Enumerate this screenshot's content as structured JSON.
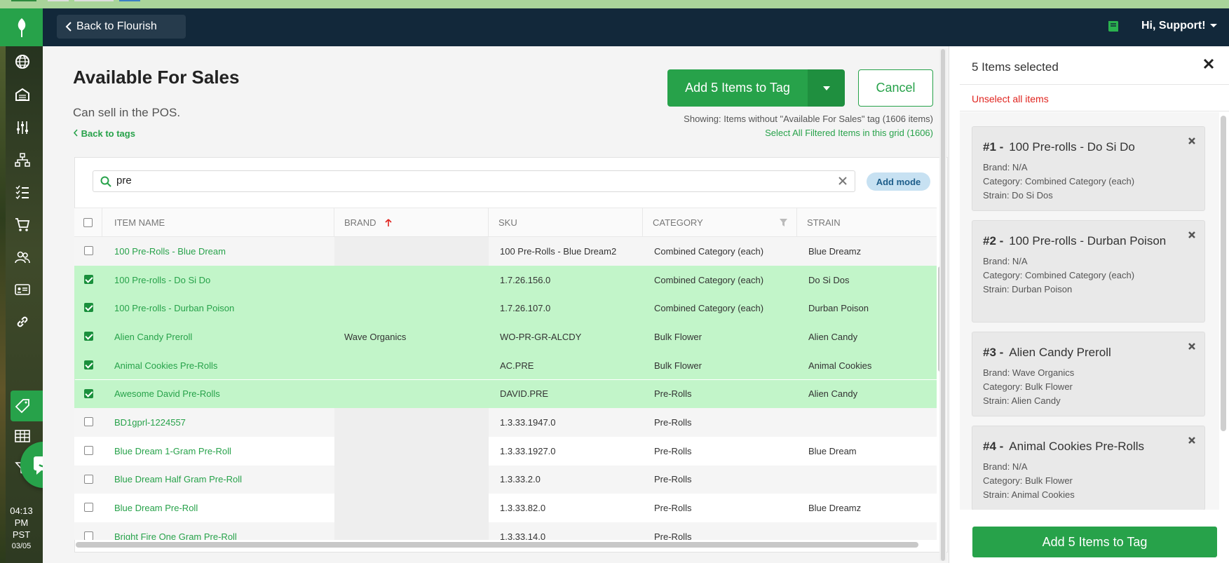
{
  "header": {
    "back_label": "Back to Flourish",
    "user_label": "Hi, Support!"
  },
  "nav_icons": [
    "globe-icon",
    "warehouse-icon",
    "sliders-icon",
    "org-chart-icon",
    "checklist-icon",
    "cart-icon",
    "users-icon",
    "id-card-icon",
    "link-icon",
    "tag-icon",
    "table-icon",
    "filter-icon"
  ],
  "clock": {
    "time": "04:13",
    "ampm": "PM",
    "tz": "PST",
    "date": "03/05"
  },
  "page": {
    "title": "Available For Sales",
    "description": "Can sell in the POS.",
    "back_to_tags": "Back to tags",
    "add_button": "Add 5 Items to Tag",
    "cancel_button": "Cancel",
    "showing": "Showing: Items without \"Available For Sales\" tag (1606 items)",
    "select_all": "Select All Filtered Items in this grid (1606)"
  },
  "search": {
    "value": "pre",
    "add_mode": "Add mode"
  },
  "columns": {
    "item_name": "ITEM NAME",
    "brand": "BRAND",
    "sku": "SKU",
    "category": "CATEGORY",
    "strain": "STRAIN"
  },
  "rows": [
    {
      "name": "100 Pre-Rolls - Blue Dream",
      "brand": "",
      "sku": "100 Pre-Rolls - Blue Dream2",
      "category": "Combined Category (each)",
      "strain": "Blue Dreamz",
      "selected": false
    },
    {
      "name": "100 Pre-rolls - Do Si Do",
      "brand": "",
      "sku": "1.7.26.156.0",
      "category": "Combined Category (each)",
      "strain": "Do Si Dos",
      "selected": true
    },
    {
      "name": "100 Pre-rolls - Durban Poison",
      "brand": "",
      "sku": "1.7.26.107.0",
      "category": "Combined Category (each)",
      "strain": "Durban Poison",
      "selected": true
    },
    {
      "name": "Alien Candy Preroll",
      "brand": "Wave Organics",
      "sku": "WO-PR-GR-ALCDY",
      "category": "Bulk Flower",
      "strain": "Alien Candy",
      "selected": true
    },
    {
      "name": "Animal Cookies Pre-Rolls",
      "brand": "",
      "sku": "AC.PRE",
      "category": "Bulk Flower",
      "strain": "Animal Cookies",
      "selected": true
    },
    {
      "name": "Awesome David Pre-Rolls",
      "brand": "",
      "sku": "DAVID.PRE",
      "category": "Pre-Rolls",
      "strain": "Alien Candy",
      "selected": true
    },
    {
      "name": "BD1gprl-1224557",
      "brand": "",
      "sku": "1.3.33.1947.0",
      "category": "Pre-Rolls",
      "strain": "",
      "selected": false
    },
    {
      "name": "Blue Dream 1-Gram Pre-Roll",
      "brand": "",
      "sku": "1.3.33.1927.0",
      "category": "Pre-Rolls",
      "strain": "Blue Dream",
      "selected": false
    },
    {
      "name": "Blue Dream Half Gram Pre-Roll",
      "brand": "",
      "sku": "1.3.33.2.0",
      "category": "Pre-Rolls",
      "strain": "",
      "selected": false
    },
    {
      "name": "Blue Dream Pre-Roll",
      "brand": "",
      "sku": "1.3.33.82.0",
      "category": "Pre-Rolls",
      "strain": "Blue Dreamz",
      "selected": false
    },
    {
      "name": "Bright Fire One Gram Pre-Roll",
      "brand": "",
      "sku": "1.3.33.14.0",
      "category": "Pre-Rolls",
      "strain": "",
      "selected": false
    }
  ],
  "selection_panel": {
    "title": "5 Items selected",
    "unselect_all": "Unselect all items",
    "items": [
      {
        "num": "#1 -",
        "name": "100 Pre-rolls - Do Si Do",
        "brand": "Brand: N/A",
        "category": "Category: Combined Category (each)",
        "strain": "Strain: Do Si Dos"
      },
      {
        "num": "#2 -",
        "name": "100 Pre-rolls - Durban Poison",
        "brand": "Brand: N/A",
        "category": "Category: Combined Category (each)",
        "strain": "Strain: Durban Poison"
      },
      {
        "num": "#3 -",
        "name": "Alien Candy Preroll",
        "brand": "Brand: Wave Organics",
        "category": "Category: Bulk Flower",
        "strain": "Strain: Alien Candy"
      },
      {
        "num": "#4 -",
        "name": "Animal Cookies Pre-Rolls",
        "brand": "Brand: N/A",
        "category": "Category: Bulk Flower",
        "strain": "Strain: Animal Cookies"
      }
    ],
    "add_button": "Add 5 Items to Tag"
  },
  "colors": {
    "accent": "#27a24a",
    "topbar": "#12283a",
    "selected_row": "#c2f5c9",
    "danger": "#e0241f"
  }
}
